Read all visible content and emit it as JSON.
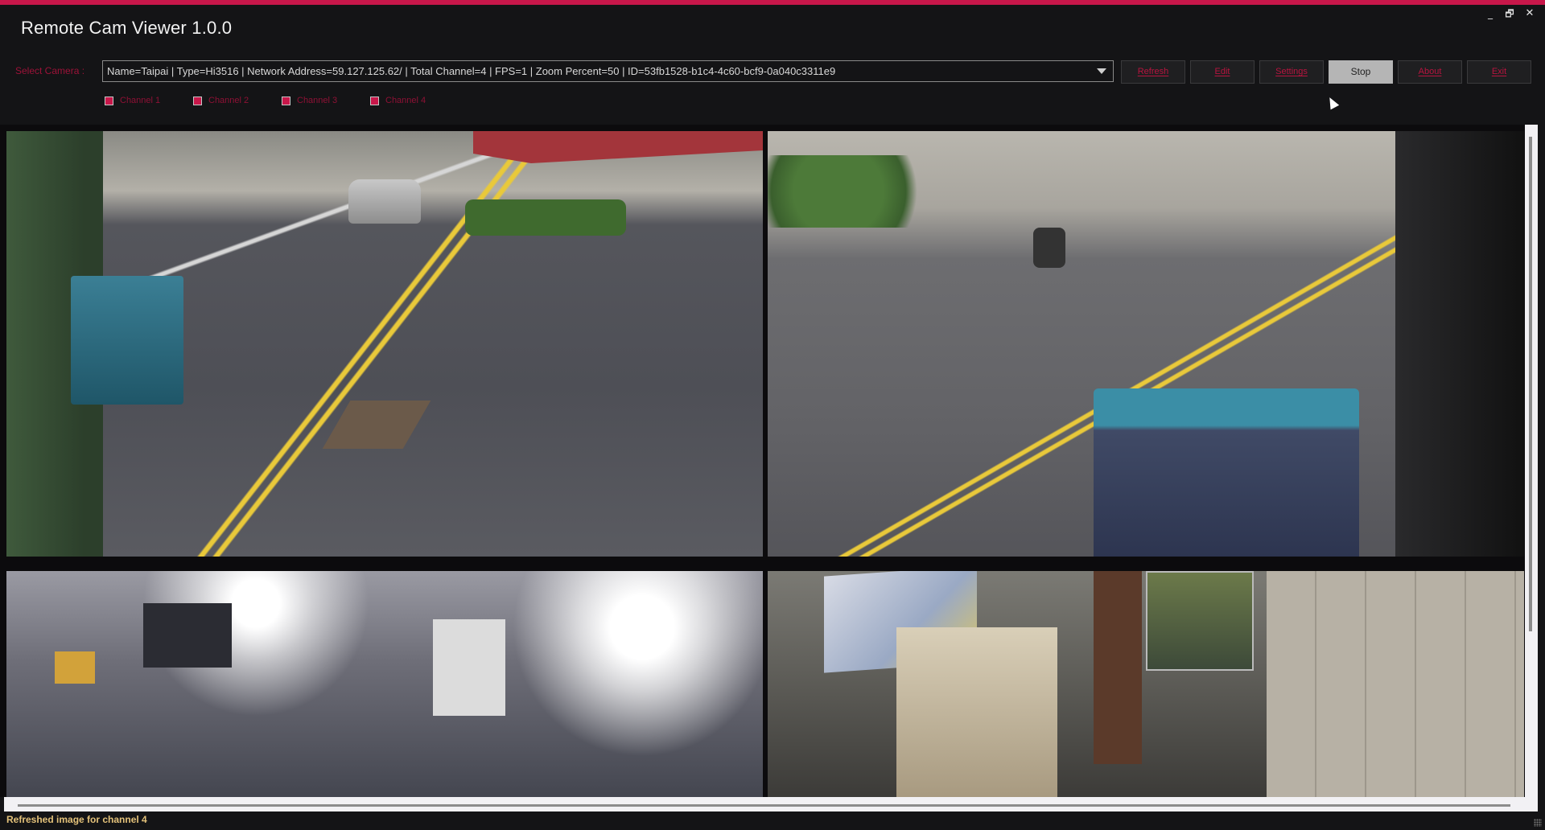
{
  "window": {
    "title": "Remote Cam Viewer 1.0.0",
    "accent_color": "#c8174a",
    "controls": {
      "minimize": "_",
      "restore": "🗗",
      "close": "✕"
    }
  },
  "toolbar": {
    "select_label": "Select Camera :",
    "camera_selected": "Name=Taipai | Type=Hi3516 | Network Address=59.127.125.62/ | Total Channel=4 | FPS=1 | Zoom Percent=50 | ID=53fb1528-b1c4-4c60-bcf9-0a040c3311e9",
    "buttons": [
      {
        "label": "Refresh",
        "active": false
      },
      {
        "label": "Edit",
        "active": false
      },
      {
        "label": "Settings",
        "active": false
      },
      {
        "label": "Stop",
        "active": true
      },
      {
        "label": "About",
        "active": false
      },
      {
        "label": "Exit",
        "active": false
      }
    ]
  },
  "channels": [
    {
      "label": "Channel 1",
      "checked": true
    },
    {
      "label": "Channel 2",
      "checked": true
    },
    {
      "label": "Channel 3",
      "checked": true
    },
    {
      "label": "Channel 4",
      "checked": true
    }
  ],
  "feeds": [
    {
      "channel": "Channel 1",
      "scene": "street-view-left"
    },
    {
      "channel": "Channel 2",
      "scene": "street-view-right"
    },
    {
      "channel": "Channel 3",
      "scene": "workshop-interior"
    },
    {
      "channel": "Channel 4",
      "scene": "office-storage-room"
    }
  ],
  "status": {
    "message": "Refreshed image for channel 4",
    "color": "#e4c27a"
  }
}
